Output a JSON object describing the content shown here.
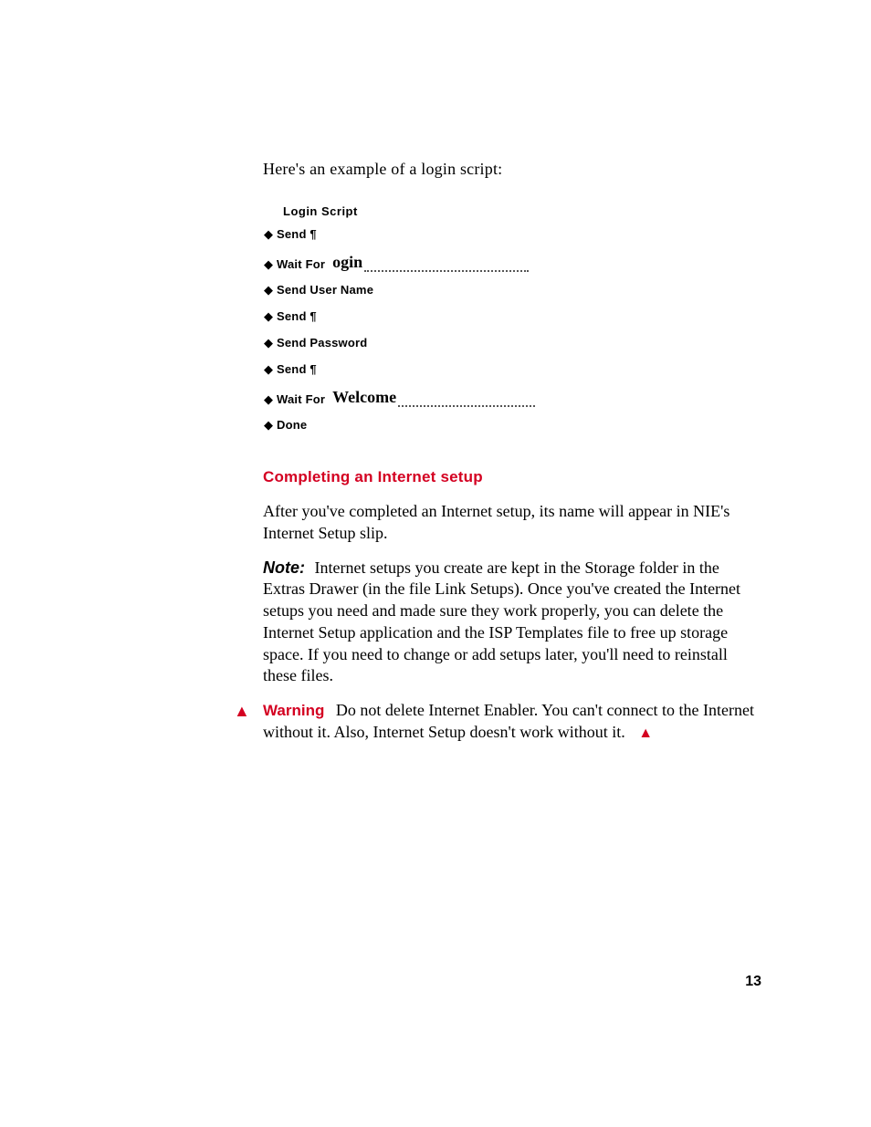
{
  "intro": "Here's an example of a login script:",
  "script": {
    "title": "Login Script",
    "rows": [
      {
        "kind": "send_para",
        "label": "Send ¶"
      },
      {
        "kind": "wait",
        "label": "Wait For",
        "value": "ogin"
      },
      {
        "kind": "plain",
        "label": "Send User Name"
      },
      {
        "kind": "send_para",
        "label": "Send ¶"
      },
      {
        "kind": "plain",
        "label": "Send Password"
      },
      {
        "kind": "send_para",
        "label": "Send ¶"
      },
      {
        "kind": "wait",
        "label": "Wait For",
        "value": "Welcome"
      },
      {
        "kind": "plain",
        "label": "Done"
      }
    ]
  },
  "section_heading": "Completing an Internet setup",
  "para_after": "After you've completed an Internet setup, its name will appear in NIE's Internet Setup slip.",
  "note": {
    "label": "Note:",
    "text": "Internet setups you create are kept in the Storage folder in the Extras Drawer (in the file Link Setups). Once you've created the Internet setups you need and made sure they work properly, you can delete the Internet Setup application and the ISP Templates file to free up storage space. If you need to change or add setups later, you'll need to reinstall these files."
  },
  "warning": {
    "label": "Warning",
    "text": "Do not delete Internet Enabler. You can't connect to the Internet without it. Also, Internet Setup doesn't work without it."
  },
  "page_number": "13"
}
